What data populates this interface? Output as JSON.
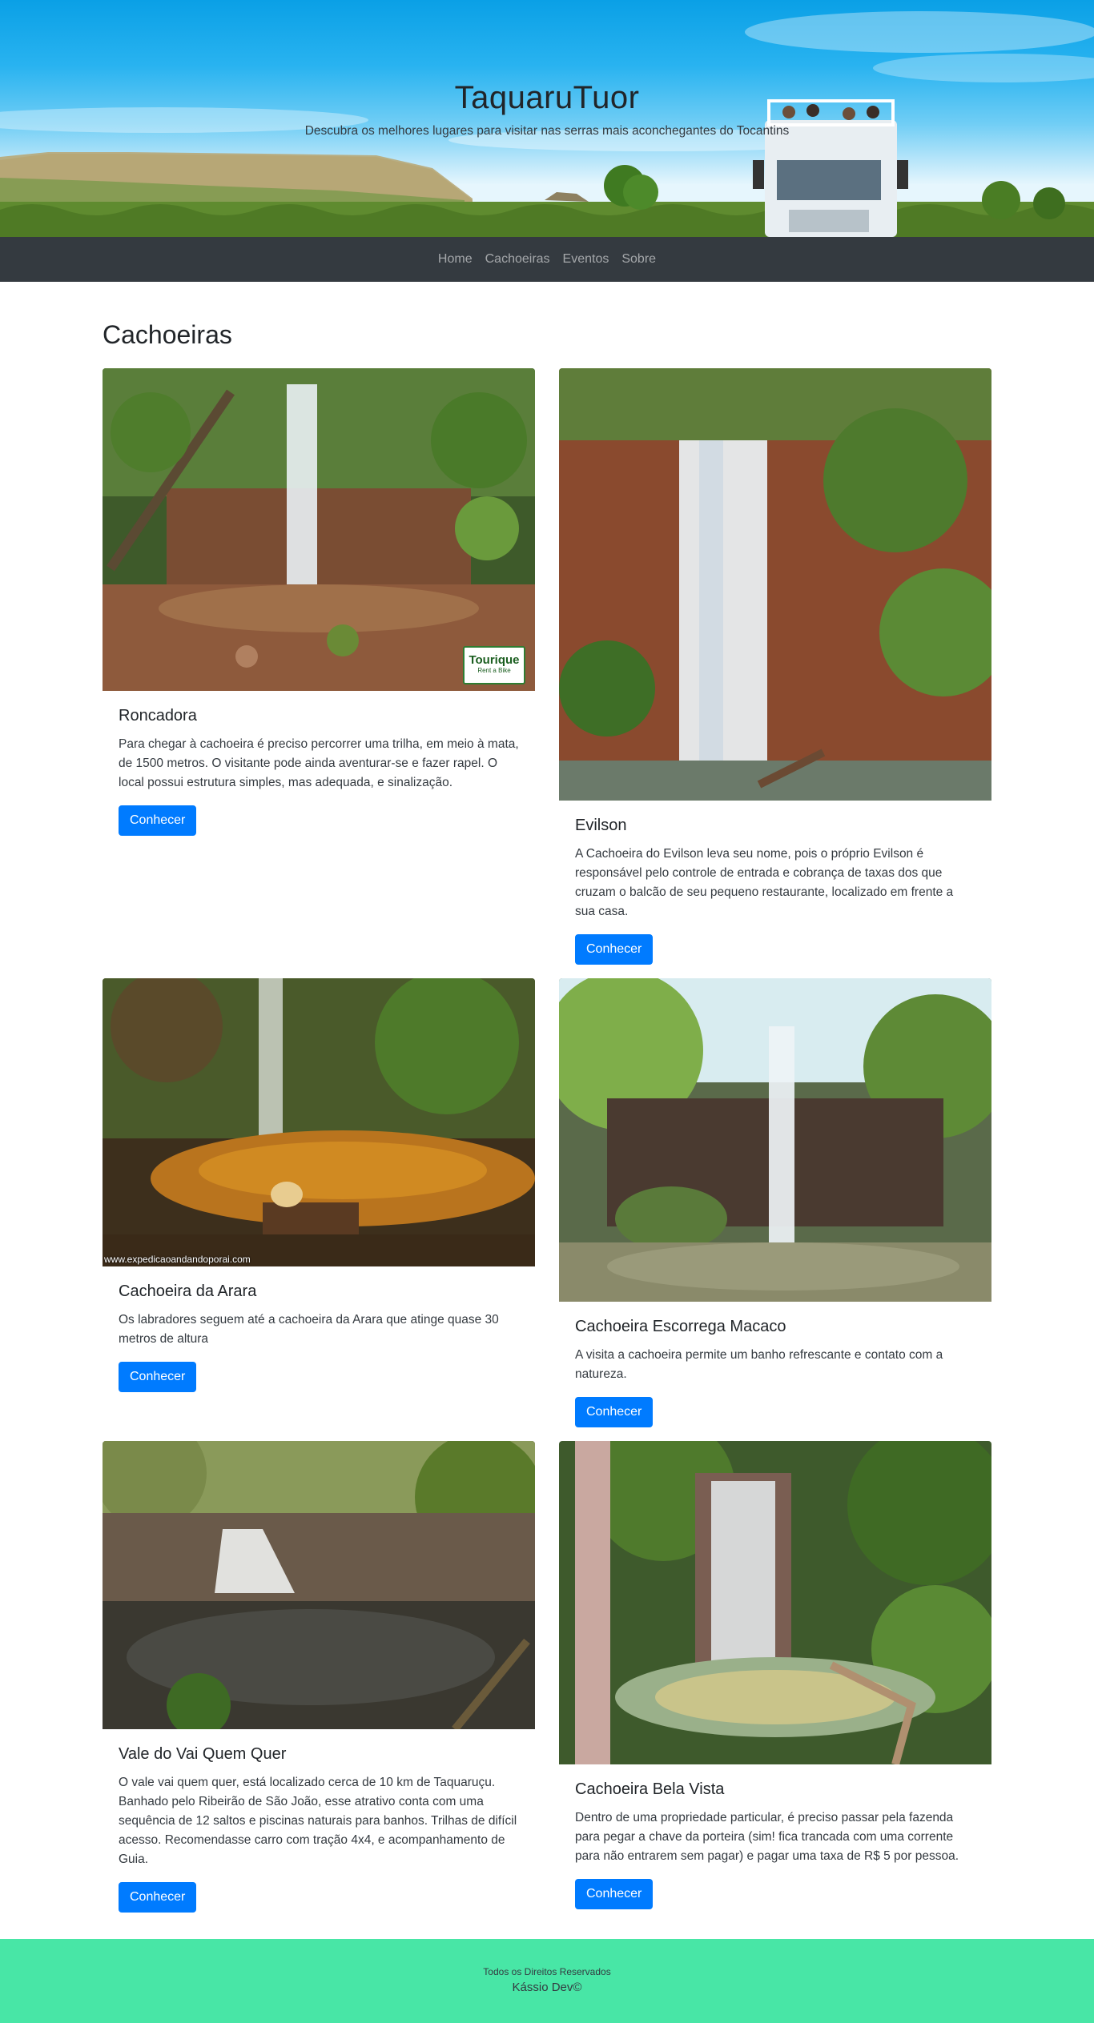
{
  "hero": {
    "title": "TaquaruTuor",
    "subtitle": "Descubra os melhores lugares para visitar nas serras mais aconchegantes do Tocantins"
  },
  "nav": {
    "items": [
      "Home",
      "Cachoeiras",
      "Eventos",
      "Sobre"
    ]
  },
  "section": {
    "title": "Cachoeiras"
  },
  "cards": [
    {
      "title": "Roncadora",
      "text": "Para chegar à cachoeira é preciso percorrer uma trilha, em meio à mata, de 1500 metros. O visitante pode ainda aventurar-se e fazer rapel. O local possui estrutura simples, mas adequada, e sinalização.",
      "button": "Conhecer",
      "image_logo": [
        "Tourique",
        "Rent a Bike"
      ]
    },
    {
      "title": "Evilson",
      "text": "A Cachoeira do Evilson leva seu nome, pois o próprio Evilson é responsável pelo controle de entrada e cobrança de taxas dos que cruzam o balcão de seu pequeno restaurante, localizado em frente a sua casa.",
      "button": "Conhecer"
    },
    {
      "title": "Cachoeira da Arara",
      "text": "Os labradores seguem até a cachoeira da Arara que atinge quase 30 metros de altura",
      "button": "Conhecer",
      "image_watermark": "www.expedicaoandandoporai.com"
    },
    {
      "title": "Cachoeira Escorrega Macaco",
      "text": "A visita a cachoeira permite um banho refrescante e contato com a natureza.",
      "button": "Conhecer"
    },
    {
      "title": "Vale do Vai Quem Quer",
      "text": "O vale vai quem quer, está localizado cerca de 10 km de Taquaruçu. Banhado pelo Ribeirão de São João, esse atrativo conta com uma sequência de 12 saltos e piscinas naturais para banhos. Trilhas de difícil acesso. Recomendasse carro com tração 4x4, e acompanhamento de Guia.",
      "button": "Conhecer"
    },
    {
      "title": "Cachoeira Bela Vista",
      "text": "Dentro de uma propriedade particular, é preciso passar pela fazenda para pegar a chave da porteira (sim! fica trancada com uma corrente para não entrarem sem pagar) e pagar uma taxa de R$ 5 por pessoa.",
      "button": "Conhecer"
    }
  ],
  "footer": {
    "rights": "Todos os Direitos Reservados",
    "author": "Kássio Dev©"
  },
  "colors": {
    "navbar_bg": "#343a40",
    "button_primary": "#007bff",
    "footer_bg": "#48e6a6"
  }
}
